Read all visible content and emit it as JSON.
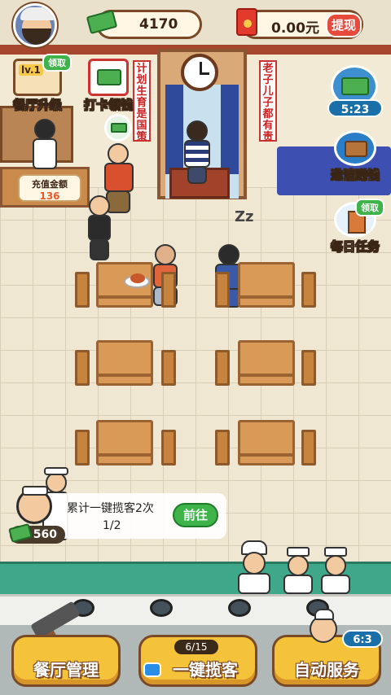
{
  "topbar": {
    "money": "4170",
    "cash": "0.00元",
    "withdraw_label": "提现"
  },
  "side_left": {
    "upgrade": {
      "level": "lv.1",
      "claim": "领取",
      "label": "餐厅升级"
    },
    "checkin": {
      "label": "打卡领钱"
    },
    "recharge": {
      "title": "充值金额",
      "amount": "136"
    }
  },
  "side_right": {
    "reward": {
      "timer": "5:23"
    },
    "invite": {
      "label": "邀请赚钱"
    },
    "daily": {
      "claim": "领取",
      "label": "每日任务"
    }
  },
  "scene": {
    "banner_left": "计划生育是国策",
    "banner_right": "老子儿子都有责",
    "sleep": "Zz"
  },
  "task": {
    "text": "累计一键揽客2次",
    "count": "1/2",
    "go_label": "前往",
    "coins": "560"
  },
  "bottom": {
    "manage_label": "餐厅管理",
    "attract_label": "一键揽客",
    "attract_progress": "6/15",
    "auto_label": "自动服务",
    "auto_ratio": "6:3"
  }
}
